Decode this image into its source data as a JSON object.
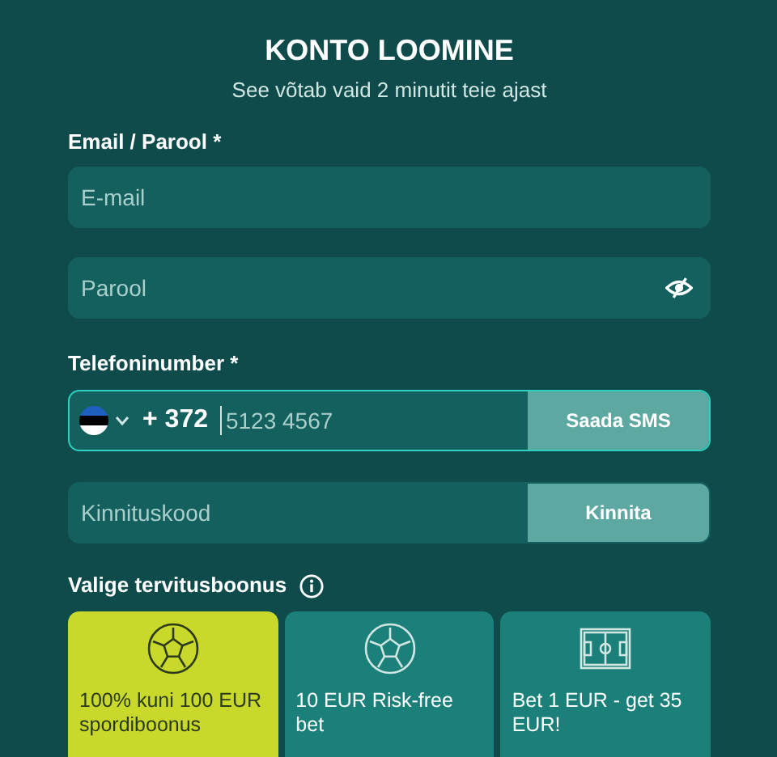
{
  "title": "KONTO LOOMINE",
  "subtitle": "See võtab vaid 2 minutit teie ajast",
  "email_section": {
    "label": "Email / Parool *",
    "email": {
      "placeholder": "E-mail"
    },
    "password": {
      "placeholder": "Parool",
      "visible": false
    }
  },
  "phone_section": {
    "label": "Telefoninumber *",
    "country_code": "+ 372",
    "phone": {
      "placeholder": "5123 4567",
      "focused": true
    },
    "send_button": "Saada SMS"
  },
  "code_field": {
    "placeholder": "Kinnituskood",
    "button": "Kinnita"
  },
  "bonus_section": {
    "label": "Valige tervitusboonus",
    "options": [
      {
        "kind": "ball",
        "text": "100% kuni 100 EUR spordiboonus",
        "selected": true
      },
      {
        "kind": "ball",
        "text": "10 EUR Risk-free bet",
        "selected": false
      },
      {
        "kind": "pitch",
        "text": "Bet 1 EUR - get 35 EUR!",
        "selected": false
      }
    ]
  }
}
